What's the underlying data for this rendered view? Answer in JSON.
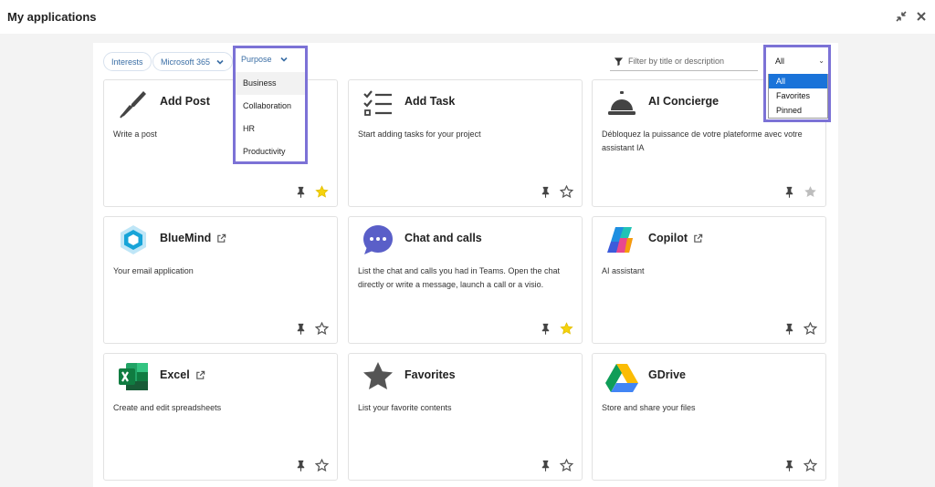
{
  "window": {
    "title": "My applications"
  },
  "filters": {
    "chips": [
      {
        "label": "Interests"
      },
      {
        "label": "Microsoft 365"
      }
    ],
    "purpose": {
      "label": "Purpose",
      "options": [
        "Business",
        "Collaboration",
        "HR",
        "Productivity"
      ]
    },
    "search": {
      "placeholder": "Filter by title or description"
    },
    "view": {
      "selected": "All",
      "options": [
        "All",
        "Favorites",
        "Pinned"
      ]
    }
  },
  "apps": [
    {
      "name": "Add Post",
      "description": "Write a post",
      "icon": "pen-icon",
      "external": false,
      "favorite": true
    },
    {
      "name": "Add Task",
      "description": "Start adding tasks for your project",
      "icon": "checklist-icon",
      "external": false,
      "favorite": false
    },
    {
      "name": "AI Concierge",
      "description": "Débloquez la puissance de votre plateforme avec votre assistant IA",
      "icon": "service-bell-icon",
      "external": false,
      "favorite": false,
      "favorite_disabled": true
    },
    {
      "name": "BlueMind",
      "description": "Your email application",
      "icon": "bluemind-logo",
      "external": true,
      "favorite": false
    },
    {
      "name": "Chat and calls",
      "description": "List the chat and calls you had in Teams. Open the chat directly or write a message, launch a call or a visio.",
      "icon": "chat-bubble-icon",
      "external": false,
      "favorite": true
    },
    {
      "name": "Copilot",
      "description": "AI assistant",
      "icon": "copilot-logo",
      "external": true,
      "favorite": false
    },
    {
      "name": "Excel",
      "description": "Create and edit spreadsheets",
      "icon": "excel-logo",
      "external": true,
      "favorite": false
    },
    {
      "name": "Favorites",
      "description": "List your favorite contents",
      "icon": "star-icon",
      "external": false,
      "favorite": false
    },
    {
      "name": "GDrive",
      "description": "Store and share your files",
      "icon": "gdrive-logo",
      "external": false,
      "favorite": false
    }
  ],
  "colors": {
    "highlight_border": "#7c72d6",
    "favorite_star": "#f5d20c",
    "selection_blue": "#1a73d9",
    "chip_text": "#3a6ea5"
  }
}
